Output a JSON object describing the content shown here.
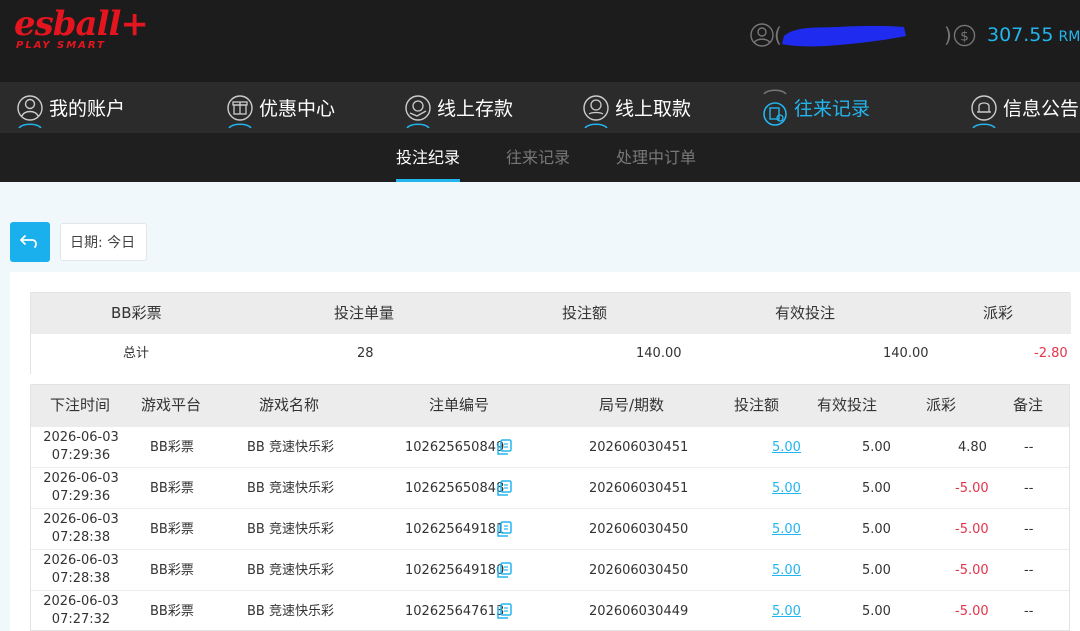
{
  "header": {
    "logo_text": "esball+",
    "logo_tagline": "PLAY SMART",
    "balance": "307.55",
    "currency": "RMB",
    "accent": "#23b5ee",
    "brand": "#e4151f"
  },
  "nav": {
    "items": [
      {
        "label": "我的账户",
        "icon": "user-icon"
      },
      {
        "label": "优惠中心",
        "icon": "gift-icon"
      },
      {
        "label": "线上存款",
        "icon": "deposit-icon"
      },
      {
        "label": "线上取款",
        "icon": "withdraw-icon"
      },
      {
        "label": "往来记录",
        "icon": "records-icon",
        "active": true
      },
      {
        "label": "信息公告",
        "icon": "bell-icon"
      }
    ]
  },
  "subnav": {
    "tabs": [
      {
        "label": "投注纪录",
        "active": true
      },
      {
        "label": "往来记录"
      },
      {
        "label": "处理中订单"
      }
    ]
  },
  "filter": {
    "date_label": "日期: 今日"
  },
  "summary": {
    "headers": [
      "BB彩票",
      "投注单量",
      "投注额",
      "有效投注",
      "派彩"
    ],
    "row": {
      "label": "总计",
      "count": "28",
      "bet": "140.00",
      "valid": "140.00",
      "payout": "-2.80"
    }
  },
  "table": {
    "headers": [
      "下注时间",
      "游戏平台",
      "游戏名称",
      "注单编号",
      "局号/期数",
      "投注额",
      "有效投注",
      "派彩",
      "备注"
    ],
    "rows": [
      {
        "date": "2026-06-03",
        "time": "07:29:36",
        "platform": "BB彩票",
        "game": "BB 竞速快乐彩",
        "order": "102625650849",
        "round": "202606030451",
        "bet": "5.00",
        "valid": "5.00",
        "payout": "4.80",
        "note": "--"
      },
      {
        "date": "2026-06-03",
        "time": "07:29:36",
        "platform": "BB彩票",
        "game": "BB 竞速快乐彩",
        "order": "102625650848",
        "round": "202606030451",
        "bet": "5.00",
        "valid": "5.00",
        "payout": "-5.00",
        "note": "--"
      },
      {
        "date": "2026-06-03",
        "time": "07:28:38",
        "platform": "BB彩票",
        "game": "BB 竞速快乐彩",
        "order": "102625649181",
        "round": "202606030450",
        "bet": "5.00",
        "valid": "5.00",
        "payout": "-5.00",
        "note": "--"
      },
      {
        "date": "2026-06-03",
        "time": "07:28:38",
        "platform": "BB彩票",
        "game": "BB 竞速快乐彩",
        "order": "102625649180",
        "round": "202606030450",
        "bet": "5.00",
        "valid": "5.00",
        "payout": "-5.00",
        "note": "--"
      },
      {
        "date": "2026-06-03",
        "time": "07:27:32",
        "platform": "BB彩票",
        "game": "BB 竞速快乐彩",
        "order": "102625647613",
        "round": "202606030449",
        "bet": "5.00",
        "valid": "5.00",
        "payout": "-5.00",
        "note": "--"
      }
    ]
  }
}
